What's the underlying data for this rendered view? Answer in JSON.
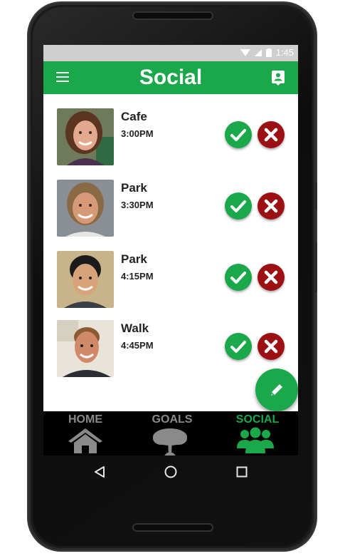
{
  "status": {
    "time": "1:45"
  },
  "appbar": {
    "title": "Social"
  },
  "items": [
    {
      "place": "Cafe",
      "time": "3:00PM"
    },
    {
      "place": "Park",
      "time": "3:30PM"
    },
    {
      "place": "Park",
      "time": "4:15PM"
    },
    {
      "place": "Walk",
      "time": "4:45PM"
    }
  ],
  "nav": {
    "home": "HOME",
    "goals": "GOALS",
    "social": "SOCIAL"
  },
  "colors": {
    "primary": "#1aa84b",
    "reject": "#9c0f12",
    "nav_inactive": "#8a8a8a"
  },
  "icons": [
    "menu-icon",
    "contact-card-icon",
    "check-icon",
    "close-icon",
    "pencil-icon",
    "home-icon",
    "tree-icon",
    "group-icon",
    "back-icon",
    "home-circle-icon",
    "recents-icon"
  ]
}
